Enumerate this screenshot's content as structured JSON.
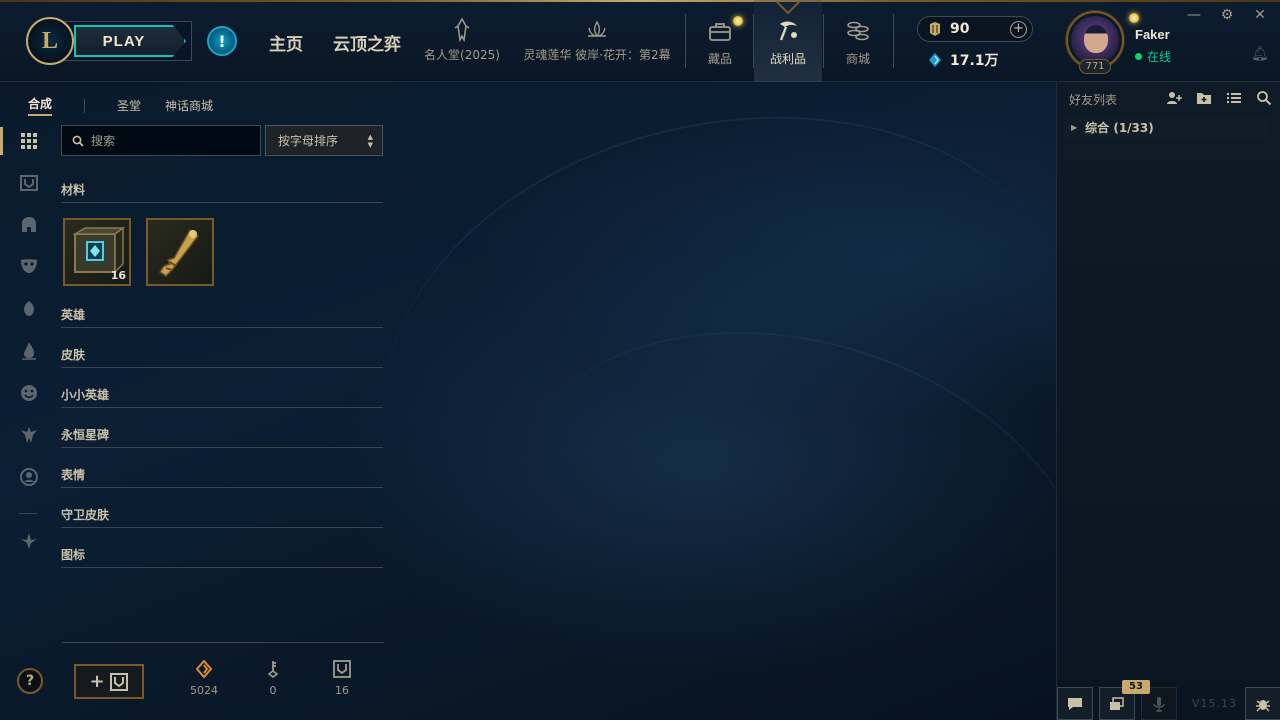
{
  "nav": {
    "play_label": "PLAY",
    "home_label": "主页",
    "tft_label": "云顶之弈",
    "event1_label": "名人堂(2025)",
    "event2_label": "灵魂莲华 彼岸·花开：第2幕",
    "collection_label": "藏品",
    "loot_label": "战利品",
    "store_label": "商城"
  },
  "currency": {
    "rp": "90",
    "be": "17.1万"
  },
  "profile": {
    "name": "Faker",
    "status": "在线",
    "level": "771"
  },
  "loot_panel": {
    "tabs": [
      "合成",
      "圣堂",
      "神话商城"
    ],
    "search_placeholder": "搜索",
    "sort_label": "按字母排序",
    "sections": [
      "材料",
      "英雄",
      "皮肤",
      "小小英雄",
      "永恒星碑",
      "表情",
      "守卫皮肤",
      "图标"
    ],
    "materials": [
      {
        "icon": "hextech-chest-icon",
        "count": "16"
      },
      {
        "icon": "key-icon",
        "count": ""
      }
    ],
    "counters": {
      "orange_essence": "5024",
      "key_fragments": "0",
      "chests": "16"
    }
  },
  "friends": {
    "title": "好友列表",
    "group_label": "综合 (1/33)",
    "notifications": "53",
    "version": "V15.13"
  },
  "colors": {
    "gold": "#c8aa6e",
    "teal": "#0ac8b9",
    "online_green": "#1ad06a"
  }
}
